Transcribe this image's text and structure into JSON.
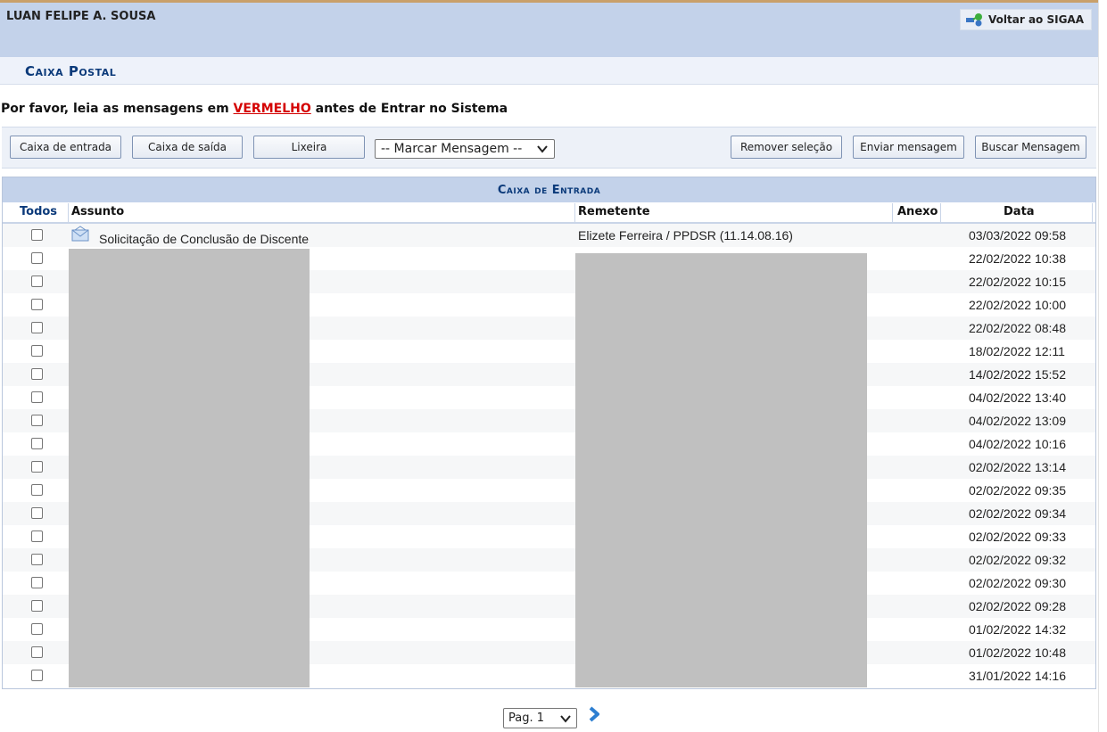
{
  "header": {
    "user_name": "LUAN FELIPE A. SOUSA",
    "back_label": "Voltar ao SIGAA"
  },
  "page_title": "Caixa Postal",
  "notice": {
    "before": "Por favor, leia as mensagens em ",
    "highlight": "VERMELHO",
    "after": " antes de Entrar no Sistema"
  },
  "toolbar": {
    "inbox_label": "Caixa de entrada",
    "outbox_label": "Caixa de saída",
    "trash_label": "Lixeira",
    "mark_select_value": "-- Marcar Mensagem --",
    "remove_label": "Remover seleção",
    "send_label": "Enviar mensagem",
    "search_label": "Buscar Mensagem"
  },
  "mailbox": {
    "caption": "Caixa de Entrada",
    "columns": {
      "todos": "Todos",
      "subject": "Assunto",
      "sender": "Remetente",
      "attachment": "Anexo",
      "date": "Data"
    },
    "rows": [
      {
        "subject": "Solicitação de Conclusão de Discente",
        "sender": "Elizete Ferreira / PPDSR (11.14.08.16)",
        "date": "03/03/2022 09:58"
      },
      {
        "subject": "",
        "sender": "",
        "date": "22/02/2022 10:38"
      },
      {
        "subject": "",
        "sender": "",
        "date": "22/02/2022 10:15"
      },
      {
        "subject": "",
        "sender": "",
        "date": "22/02/2022 10:00"
      },
      {
        "subject": "",
        "sender": "",
        "date": "22/02/2022 08:48"
      },
      {
        "subject": "",
        "sender": "",
        "date": "18/02/2022 12:11"
      },
      {
        "subject": "",
        "sender": "",
        "date": "14/02/2022 15:52"
      },
      {
        "subject": "",
        "sender": "",
        "date": "04/02/2022 13:40"
      },
      {
        "subject": "",
        "sender": "",
        "date": "04/02/2022 13:09"
      },
      {
        "subject": "",
        "sender": "",
        "date": "04/02/2022 10:16"
      },
      {
        "subject": "",
        "sender": "",
        "date": "02/02/2022 13:14"
      },
      {
        "subject": "",
        "sender": "",
        "date": "02/02/2022 09:35"
      },
      {
        "subject": "",
        "sender": "",
        "date": "02/02/2022 09:34"
      },
      {
        "subject": "",
        "sender": "",
        "date": "02/02/2022 09:33"
      },
      {
        "subject": "",
        "sender": "",
        "date": "02/02/2022 09:32"
      },
      {
        "subject": "",
        "sender": "",
        "date": "02/02/2022 09:30"
      },
      {
        "subject": "",
        "sender": "",
        "date": "02/02/2022 09:28"
      },
      {
        "subject": "",
        "sender": "",
        "date": "01/02/2022 14:32"
      },
      {
        "subject": "",
        "sender": "",
        "date": "01/02/2022 10:48"
      },
      {
        "subject": "",
        "sender": "",
        "date": "31/01/2022 14:16"
      }
    ]
  },
  "pagination": {
    "page_select_value": "Pag. 1"
  },
  "colors": {
    "header_bg": "#c3d2ea",
    "title_blue": "#0b3a7a",
    "alert_red": "#d40000"
  },
  "icons": [
    "sigaa-back-icon",
    "envelope-icon",
    "next-page-arrow-icon"
  ]
}
